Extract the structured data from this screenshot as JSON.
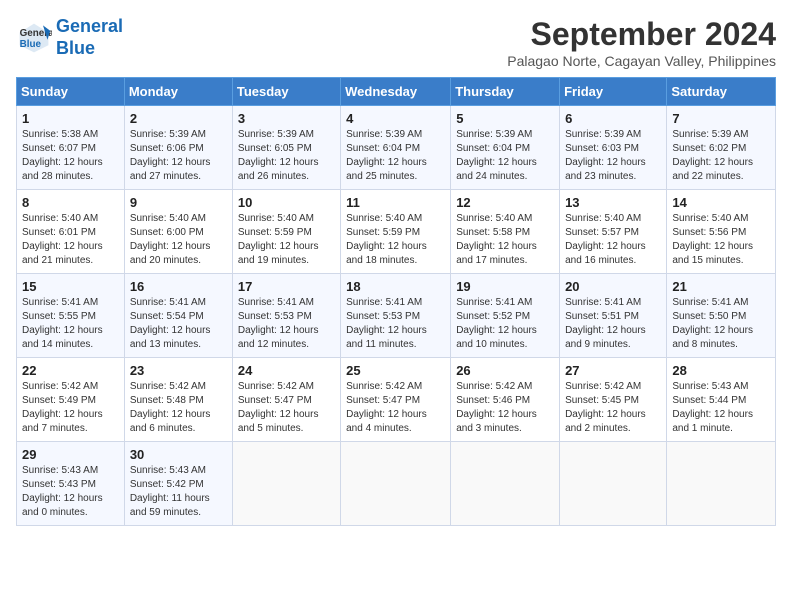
{
  "logo": {
    "line1": "General",
    "line2": "Blue"
  },
  "title": "September 2024",
  "subtitle": "Palagao Norte, Cagayan Valley, Philippines",
  "weekdays": [
    "Sunday",
    "Monday",
    "Tuesday",
    "Wednesday",
    "Thursday",
    "Friday",
    "Saturday"
  ],
  "weeks": [
    [
      {
        "day": "1",
        "lines": [
          "Sunrise: 5:38 AM",
          "Sunset: 6:07 PM",
          "Daylight: 12 hours",
          "and 28 minutes."
        ]
      },
      {
        "day": "2",
        "lines": [
          "Sunrise: 5:39 AM",
          "Sunset: 6:06 PM",
          "Daylight: 12 hours",
          "and 27 minutes."
        ]
      },
      {
        "day": "3",
        "lines": [
          "Sunrise: 5:39 AM",
          "Sunset: 6:05 PM",
          "Daylight: 12 hours",
          "and 26 minutes."
        ]
      },
      {
        "day": "4",
        "lines": [
          "Sunrise: 5:39 AM",
          "Sunset: 6:04 PM",
          "Daylight: 12 hours",
          "and 25 minutes."
        ]
      },
      {
        "day": "5",
        "lines": [
          "Sunrise: 5:39 AM",
          "Sunset: 6:04 PM",
          "Daylight: 12 hours",
          "and 24 minutes."
        ]
      },
      {
        "day": "6",
        "lines": [
          "Sunrise: 5:39 AM",
          "Sunset: 6:03 PM",
          "Daylight: 12 hours",
          "and 23 minutes."
        ]
      },
      {
        "day": "7",
        "lines": [
          "Sunrise: 5:39 AM",
          "Sunset: 6:02 PM",
          "Daylight: 12 hours",
          "and 22 minutes."
        ]
      }
    ],
    [
      {
        "day": "8",
        "lines": [
          "Sunrise: 5:40 AM",
          "Sunset: 6:01 PM",
          "Daylight: 12 hours",
          "and 21 minutes."
        ]
      },
      {
        "day": "9",
        "lines": [
          "Sunrise: 5:40 AM",
          "Sunset: 6:00 PM",
          "Daylight: 12 hours",
          "and 20 minutes."
        ]
      },
      {
        "day": "10",
        "lines": [
          "Sunrise: 5:40 AM",
          "Sunset: 5:59 PM",
          "Daylight: 12 hours",
          "and 19 minutes."
        ]
      },
      {
        "day": "11",
        "lines": [
          "Sunrise: 5:40 AM",
          "Sunset: 5:59 PM",
          "Daylight: 12 hours",
          "and 18 minutes."
        ]
      },
      {
        "day": "12",
        "lines": [
          "Sunrise: 5:40 AM",
          "Sunset: 5:58 PM",
          "Daylight: 12 hours",
          "and 17 minutes."
        ]
      },
      {
        "day": "13",
        "lines": [
          "Sunrise: 5:40 AM",
          "Sunset: 5:57 PM",
          "Daylight: 12 hours",
          "and 16 minutes."
        ]
      },
      {
        "day": "14",
        "lines": [
          "Sunrise: 5:40 AM",
          "Sunset: 5:56 PM",
          "Daylight: 12 hours",
          "and 15 minutes."
        ]
      }
    ],
    [
      {
        "day": "15",
        "lines": [
          "Sunrise: 5:41 AM",
          "Sunset: 5:55 PM",
          "Daylight: 12 hours",
          "and 14 minutes."
        ]
      },
      {
        "day": "16",
        "lines": [
          "Sunrise: 5:41 AM",
          "Sunset: 5:54 PM",
          "Daylight: 12 hours",
          "and 13 minutes."
        ]
      },
      {
        "day": "17",
        "lines": [
          "Sunrise: 5:41 AM",
          "Sunset: 5:53 PM",
          "Daylight: 12 hours",
          "and 12 minutes."
        ]
      },
      {
        "day": "18",
        "lines": [
          "Sunrise: 5:41 AM",
          "Sunset: 5:53 PM",
          "Daylight: 12 hours",
          "and 11 minutes."
        ]
      },
      {
        "day": "19",
        "lines": [
          "Sunrise: 5:41 AM",
          "Sunset: 5:52 PM",
          "Daylight: 12 hours",
          "and 10 minutes."
        ]
      },
      {
        "day": "20",
        "lines": [
          "Sunrise: 5:41 AM",
          "Sunset: 5:51 PM",
          "Daylight: 12 hours",
          "and 9 minutes."
        ]
      },
      {
        "day": "21",
        "lines": [
          "Sunrise: 5:41 AM",
          "Sunset: 5:50 PM",
          "Daylight: 12 hours",
          "and 8 minutes."
        ]
      }
    ],
    [
      {
        "day": "22",
        "lines": [
          "Sunrise: 5:42 AM",
          "Sunset: 5:49 PM",
          "Daylight: 12 hours",
          "and 7 minutes."
        ]
      },
      {
        "day": "23",
        "lines": [
          "Sunrise: 5:42 AM",
          "Sunset: 5:48 PM",
          "Daylight: 12 hours",
          "and 6 minutes."
        ]
      },
      {
        "day": "24",
        "lines": [
          "Sunrise: 5:42 AM",
          "Sunset: 5:47 PM",
          "Daylight: 12 hours",
          "and 5 minutes."
        ]
      },
      {
        "day": "25",
        "lines": [
          "Sunrise: 5:42 AM",
          "Sunset: 5:47 PM",
          "Daylight: 12 hours",
          "and 4 minutes."
        ]
      },
      {
        "day": "26",
        "lines": [
          "Sunrise: 5:42 AM",
          "Sunset: 5:46 PM",
          "Daylight: 12 hours",
          "and 3 minutes."
        ]
      },
      {
        "day": "27",
        "lines": [
          "Sunrise: 5:42 AM",
          "Sunset: 5:45 PM",
          "Daylight: 12 hours",
          "and 2 minutes."
        ]
      },
      {
        "day": "28",
        "lines": [
          "Sunrise: 5:43 AM",
          "Sunset: 5:44 PM",
          "Daylight: 12 hours",
          "and 1 minute."
        ]
      }
    ],
    [
      {
        "day": "29",
        "lines": [
          "Sunrise: 5:43 AM",
          "Sunset: 5:43 PM",
          "Daylight: 12 hours",
          "and 0 minutes."
        ]
      },
      {
        "day": "30",
        "lines": [
          "Sunrise: 5:43 AM",
          "Sunset: 5:42 PM",
          "Daylight: 11 hours",
          "and 59 minutes."
        ]
      },
      null,
      null,
      null,
      null,
      null
    ]
  ]
}
